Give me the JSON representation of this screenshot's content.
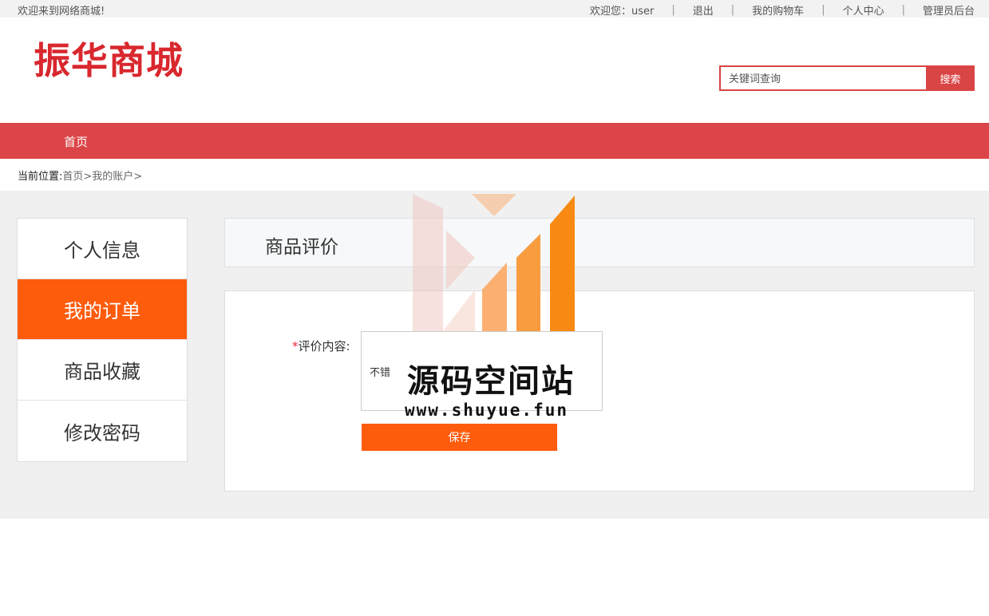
{
  "topbar": {
    "welcome": "欢迎来到网络商城!",
    "user_greeting": "欢迎您：user",
    "logout": "退出",
    "cart": "我的购物车",
    "profile_center": "个人中心",
    "admin": "管理员后台"
  },
  "header": {
    "logo_text": "振华商城",
    "search_placeholder": "关键词查询",
    "search_button": "搜索"
  },
  "nav": {
    "home": "首页"
  },
  "breadcrumb": {
    "label": "当前位置:",
    "path": "首页>我的账户>"
  },
  "sidebar": {
    "items": [
      {
        "label": "个人信息",
        "active": false
      },
      {
        "label": "我的订单",
        "active": true
      },
      {
        "label": "商品收藏",
        "active": false
      },
      {
        "label": "修改密码",
        "active": false
      }
    ]
  },
  "main": {
    "title": "商品评价",
    "form": {
      "required_mark": "*",
      "label": "评价内容:",
      "value": "不错",
      "save_button": "保存"
    }
  },
  "watermark": {
    "text": "源码空间站",
    "url": "www.shuyue.fun"
  },
  "colors": {
    "brand_red": "#dc4547",
    "accent_orange": "#fe5c0d"
  }
}
